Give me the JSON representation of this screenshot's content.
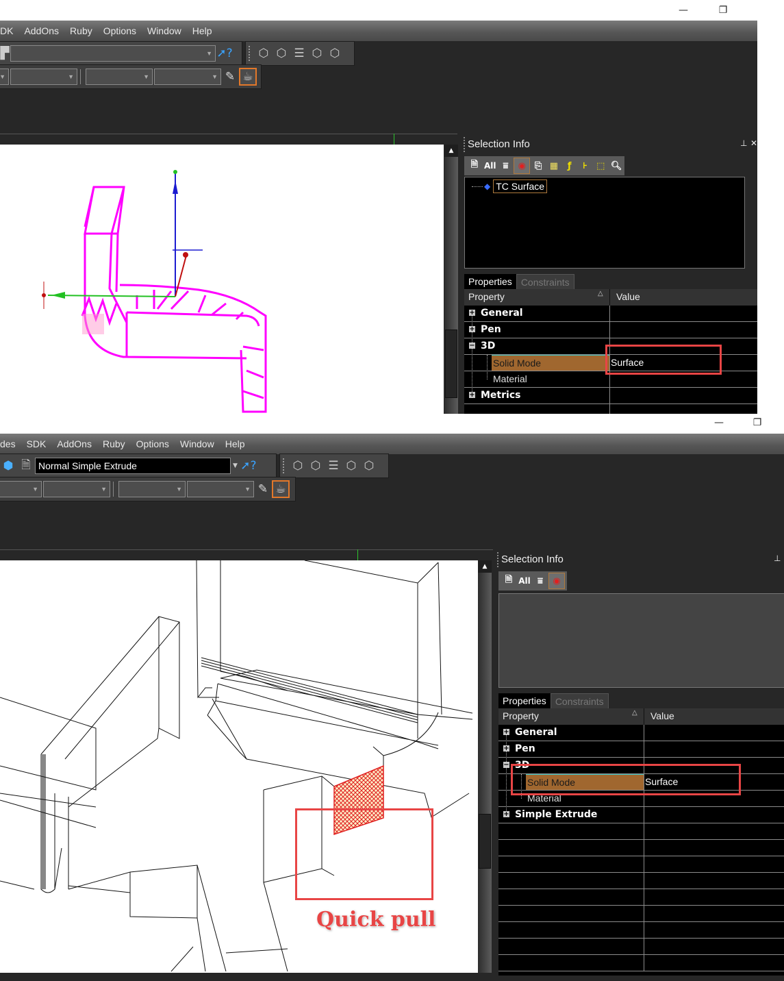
{
  "window_controls": {
    "minimize": "—",
    "restore": "❐",
    "close": "✕"
  },
  "top": {
    "menu": [
      "DK",
      "AddOns",
      "Ruby",
      "Options",
      "Window",
      "Help"
    ],
    "toolbar": {
      "mode_combo_value": "",
      "help_icon": "whats-this-help-icon",
      "extrude_icons": [
        "extrude-icon",
        "extrude-icon",
        "sweep-icon",
        "extrude-icon",
        "extrude-icon"
      ],
      "style_combos": [
        "",
        "",
        "",
        ""
      ],
      "pencil_icon": "pencil-icon",
      "render_icon": "render-style-icon"
    },
    "selection_info": {
      "title": "Selection Info",
      "pin": "⊥",
      "close": "✕",
      "toolbar_icons": [
        "properties-icon",
        "all-icon",
        "filter-icon",
        "visibility-icon",
        "copy-icon",
        "table-icon",
        "function-icon",
        "dimension-icon",
        "select-box-icon",
        "zoom-icon"
      ],
      "all_label": "All",
      "tree": [
        {
          "label": "TC Surface",
          "icon": "surface-icon"
        }
      ],
      "tabs": [
        "Properties",
        "Constraints"
      ],
      "columns": [
        "Property",
        "Value"
      ],
      "rows": [
        {
          "type": "category",
          "expander": "+",
          "label": "General",
          "value": ""
        },
        {
          "type": "category",
          "expander": "+",
          "label": "Pen",
          "value": ""
        },
        {
          "type": "category",
          "expander": "−",
          "label": "3D",
          "value": ""
        },
        {
          "type": "property",
          "label": "Solid Mode",
          "value": "Surface",
          "selected": true
        },
        {
          "type": "property",
          "label": "Material",
          "value": ""
        },
        {
          "type": "category",
          "expander": "+",
          "label": "Metrics",
          "value": ""
        }
      ]
    }
  },
  "bottom": {
    "menu": [
      "des",
      "SDK",
      "AddOns",
      "Ruby",
      "Options",
      "Window",
      "Help"
    ],
    "toolbar": {
      "mode_combo_value": "Normal Simple Extrude",
      "style_combos": [
        "",
        "",
        "",
        ""
      ]
    },
    "selection_info": {
      "title": "Selection Info",
      "pin": "⊥",
      "all_label": "All",
      "toolbar_icons": [
        "properties-icon",
        "all-icon",
        "filter-icon",
        "visibility-icon"
      ],
      "tabs": [
        "Properties",
        "Constraints"
      ],
      "columns": [
        "Property",
        "Value"
      ],
      "rows": [
        {
          "type": "category",
          "expander": "+",
          "label": "General",
          "value": ""
        },
        {
          "type": "category",
          "expander": "+",
          "label": "Pen",
          "value": ""
        },
        {
          "type": "category",
          "expander": "−",
          "label": "3D",
          "value": ""
        },
        {
          "type": "property",
          "label": "Solid Mode",
          "value": "Surface",
          "selected": true
        },
        {
          "type": "property",
          "label": "Material",
          "value": ""
        },
        {
          "type": "category",
          "expander": "+",
          "label": "Simple Extrude",
          "value": ""
        }
      ]
    },
    "annotation": "Quick pull"
  },
  "colors": {
    "accent_orange": "#e3782a",
    "selected_row": "#a0672f",
    "annotation_red": "#e84545",
    "wireframe_magenta": "#ff00ff"
  }
}
